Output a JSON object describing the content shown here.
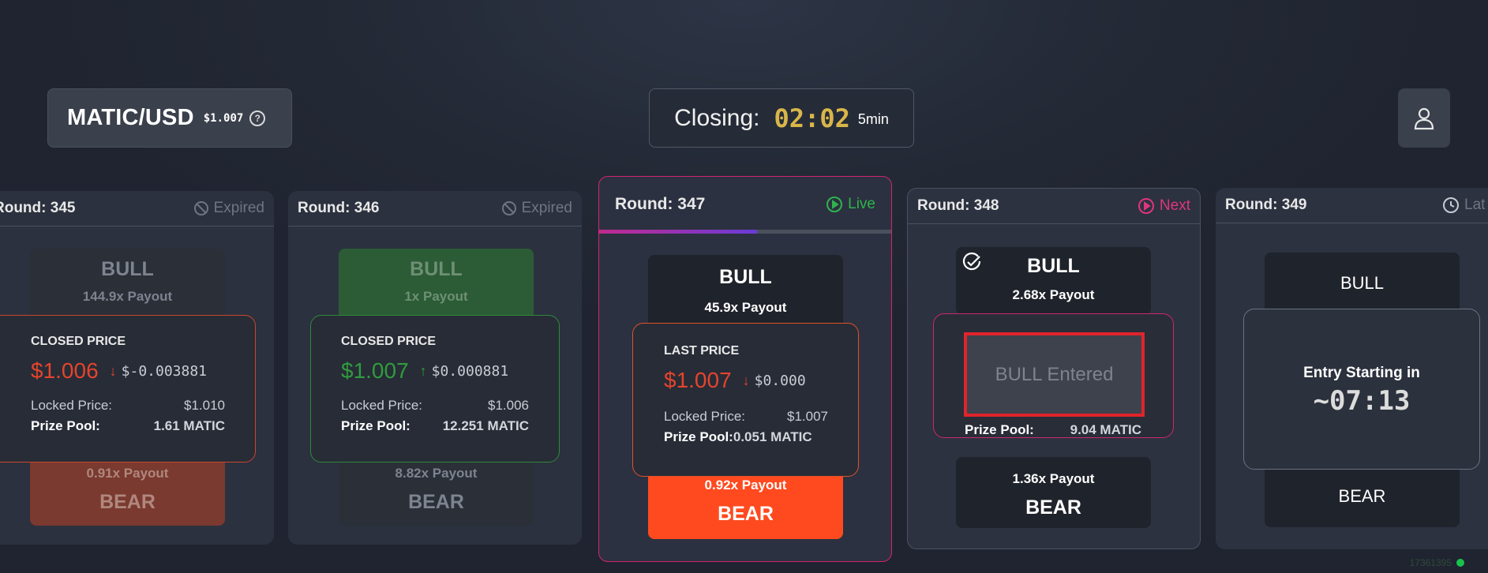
{
  "header": {
    "pair": "MATIC/USD",
    "price": "$1.007",
    "closing_label": "Closing:",
    "closing_time": "02:02",
    "interval": "5min"
  },
  "rounds": [
    {
      "round_label": "Round: 345",
      "status": "Expired",
      "bull_label": "BULL",
      "bull_payout": "144.9x Payout",
      "inner_title": "CLOSED PRICE",
      "price": "$1.006",
      "change": "$-0.003881",
      "locked_label": "Locked Price:",
      "locked_price": "$1.010",
      "pool_label": "Prize Pool:",
      "pool_value": "1.61 MATIC",
      "bear_payout": "0.91x Payout",
      "bear_label": "BEAR"
    },
    {
      "round_label": "Round: 346",
      "status": "Expired",
      "bull_label": "BULL",
      "bull_payout": "1x Payout",
      "inner_title": "CLOSED PRICE",
      "price": "$1.007",
      "change": "$0.000881",
      "locked_label": "Locked Price:",
      "locked_price": "$1.006",
      "pool_label": "Prize Pool:",
      "pool_value": "12.251 MATIC",
      "bear_payout": "8.82x Payout",
      "bear_label": "BEAR"
    },
    {
      "round_label": "Round: 347",
      "status": "Live",
      "progress": 0.54,
      "bull_label": "BULL",
      "bull_payout": "45.9x Payout",
      "inner_title": "LAST PRICE",
      "price": "$1.007",
      "change": "$0.000",
      "locked_label": "Locked Price:",
      "locked_price": "$1.007",
      "pool_label": "Prize Pool:",
      "pool_value": "0.051 MATIC",
      "bear_payout": "0.92x Payout",
      "bear_label": "BEAR"
    },
    {
      "round_label": "Round: 348",
      "status": "Next",
      "bull_label": "BULL",
      "bull_payout": "2.68x Payout",
      "entered_label": "BULL Entered",
      "pool_label": "Prize Pool:",
      "pool_value": "9.04 MATIC",
      "bear_payout": "1.36x Payout",
      "bear_label": "BEAR"
    },
    {
      "round_label": "Round: 349",
      "status": "Lat",
      "bull_label": "BULL",
      "entry_label": "Entry Starting in",
      "entry_time": "~07:13",
      "bear_label": "BEAR"
    }
  ],
  "footer": {
    "id": "17361395"
  },
  "colors": {
    "red": "#e5442b",
    "green": "#2f9c3c",
    "live": "#2fb44c",
    "next": "#e0357a",
    "bear_active": "#ff4a1f",
    "gold": "#d9b64a"
  }
}
